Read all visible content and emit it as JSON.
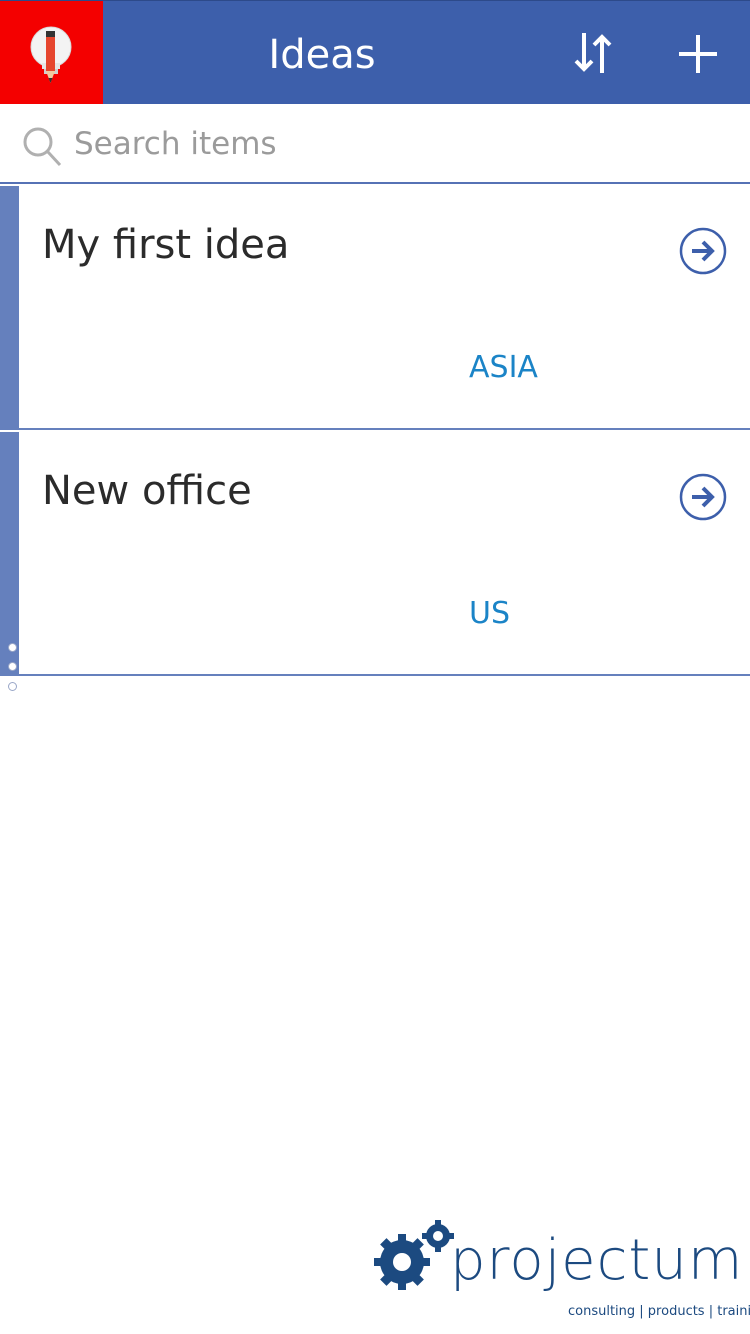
{
  "header": {
    "title": "Ideas",
    "logo_icon": "lightbulb-pencil-icon",
    "sort_icon": "sort-arrows-icon",
    "add_icon": "plus-icon",
    "bg_color": "#3d5fab",
    "logo_bg_color": "#f40000"
  },
  "search": {
    "placeholder": "Search items",
    "value": "",
    "icon": "search-icon"
  },
  "items": [
    {
      "title": "My first idea",
      "region": "ASIA",
      "icon": "arrow-right-circle-icon"
    },
    {
      "title": "New office",
      "region": "US",
      "icon": "arrow-right-circle-icon"
    }
  ],
  "footer": {
    "brand_name": "projectum",
    "brand_tagline": "consulting | products | training",
    "brand_icon": "gears-icon"
  },
  "colors": {
    "accent": "#6580bd",
    "region_text": "#1b84c7",
    "brand": "#1c4a80"
  }
}
